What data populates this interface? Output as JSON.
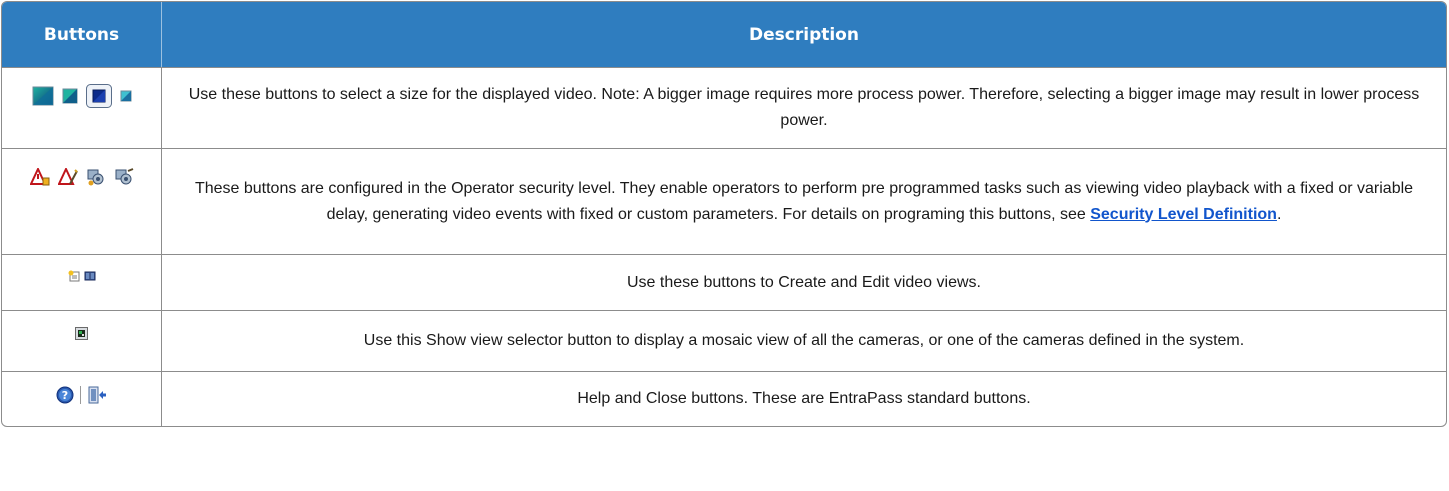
{
  "table": {
    "headers": {
      "buttons": "Buttons",
      "description": "Description"
    },
    "rows": [
      {
        "icons": [
          "size-large-icon",
          "size-medium-icon",
          "size-selected-icon",
          "size-small-icon"
        ],
        "description": "Use these buttons to select a size for the displayed video. Note: A bigger image requires more process power. Therefore, selecting a bigger image may result in lower process power."
      },
      {
        "icons": [
          "alarm-warning-icon",
          "alarm-edit-icon",
          "event-settings-icon",
          "event-custom-icon"
        ],
        "description_before": "These buttons are configured in the Operator security level. They enable operators to perform pre programmed tasks such as viewing video playback with a fixed or variable delay, generating video events with fixed or custom parameters. For details on programing this buttons, see ",
        "link_text": "Security Level Definition",
        "description_after": "."
      },
      {
        "icons": [
          "create-view-icon",
          "edit-view-icon"
        ],
        "description": "Use these buttons to Create and Edit video views."
      },
      {
        "icons": [
          "view-selector-icon"
        ],
        "description": "Use this Show view selector button to display a mosaic view of all the cameras, or one of the cameras defined in the system."
      },
      {
        "icons": [
          "help-icon",
          "close-icon"
        ],
        "description": "Help and Close buttons. These are EntraPass standard buttons."
      }
    ]
  },
  "colors": {
    "header_bg": "#2f7dbf",
    "header_text": "#ffffff",
    "link": "#1155cc",
    "border": "#8c8c8c"
  }
}
